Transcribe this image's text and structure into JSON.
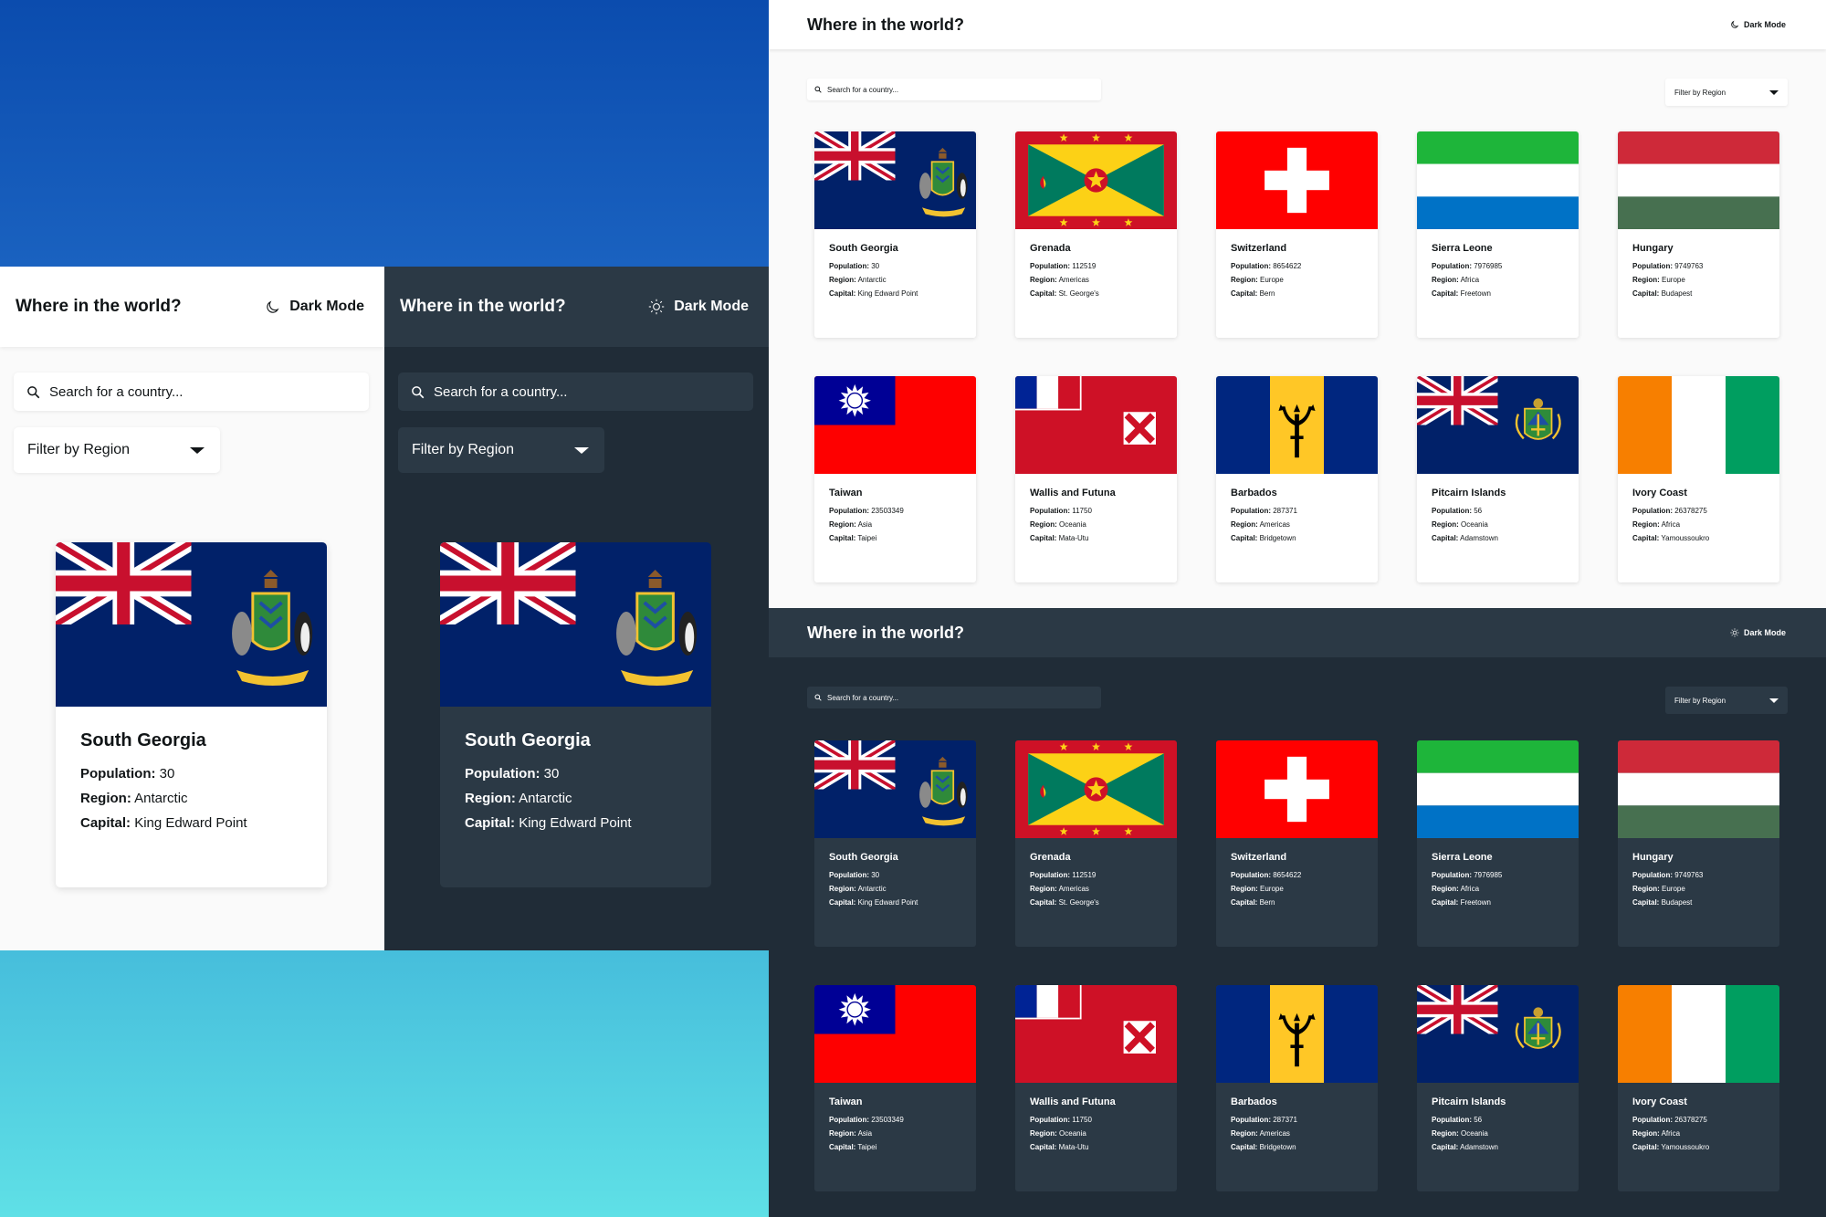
{
  "app": {
    "title": "Where in the world?",
    "mode_label": "Dark Mode",
    "search_placeholder": "Search for a country...",
    "filter_label": "Filter by Region"
  },
  "labels": {
    "population": "Population:",
    "region": "Region:",
    "capital": "Capital:"
  },
  "mobile_country": {
    "name": "South Georgia",
    "population": "30",
    "region": "Antarctic",
    "capital": "King Edward Point",
    "flag": "south-georgia"
  },
  "countries": [
    {
      "name": "South Georgia",
      "population": "30",
      "region": "Antarctic",
      "capital": "King Edward Point",
      "flag": "south-georgia"
    },
    {
      "name": "Grenada",
      "population": "112519",
      "region": "Americas",
      "capital": "St. George's",
      "flag": "grenada"
    },
    {
      "name": "Switzerland",
      "population": "8654622",
      "region": "Europe",
      "capital": "Bern",
      "flag": "switzerland"
    },
    {
      "name": "Sierra Leone",
      "population": "7976985",
      "region": "Africa",
      "capital": "Freetown",
      "flag": "sierra-leone"
    },
    {
      "name": "Hungary",
      "population": "9749763",
      "region": "Europe",
      "capital": "Budapest",
      "flag": "hungary"
    },
    {
      "name": "Taiwan",
      "population": "23503349",
      "region": "Asia",
      "capital": "Taipei",
      "flag": "taiwan"
    },
    {
      "name": "Wallis and Futuna",
      "population": "11750",
      "region": "Oceania",
      "capital": "Mata-Utu",
      "flag": "wallis-futuna"
    },
    {
      "name": "Barbados",
      "population": "287371",
      "region": "Americas",
      "capital": "Bridgetown",
      "flag": "barbados"
    },
    {
      "name": "Pitcairn Islands",
      "population": "56",
      "region": "Oceania",
      "capital": "Adamstown",
      "flag": "pitcairn"
    },
    {
      "name": "Ivory Coast",
      "population": "26378275",
      "region": "Africa",
      "capital": "Yamoussoukro",
      "flag": "ivory-coast"
    }
  ],
  "colors": {
    "light_bg": "#fafafa",
    "light_element": "#ffffff",
    "light_text": "#111517",
    "dark_bg": "#202c37",
    "dark_element": "#2b3945",
    "dark_text": "#ffffff",
    "brand_blue": "#0b4cae",
    "brand_cyan": "#5fe0e6"
  },
  "icons": {
    "moon": "moon-icon",
    "sun": "sun-icon",
    "search": "search-icon",
    "caret": "chevron-down-icon"
  }
}
